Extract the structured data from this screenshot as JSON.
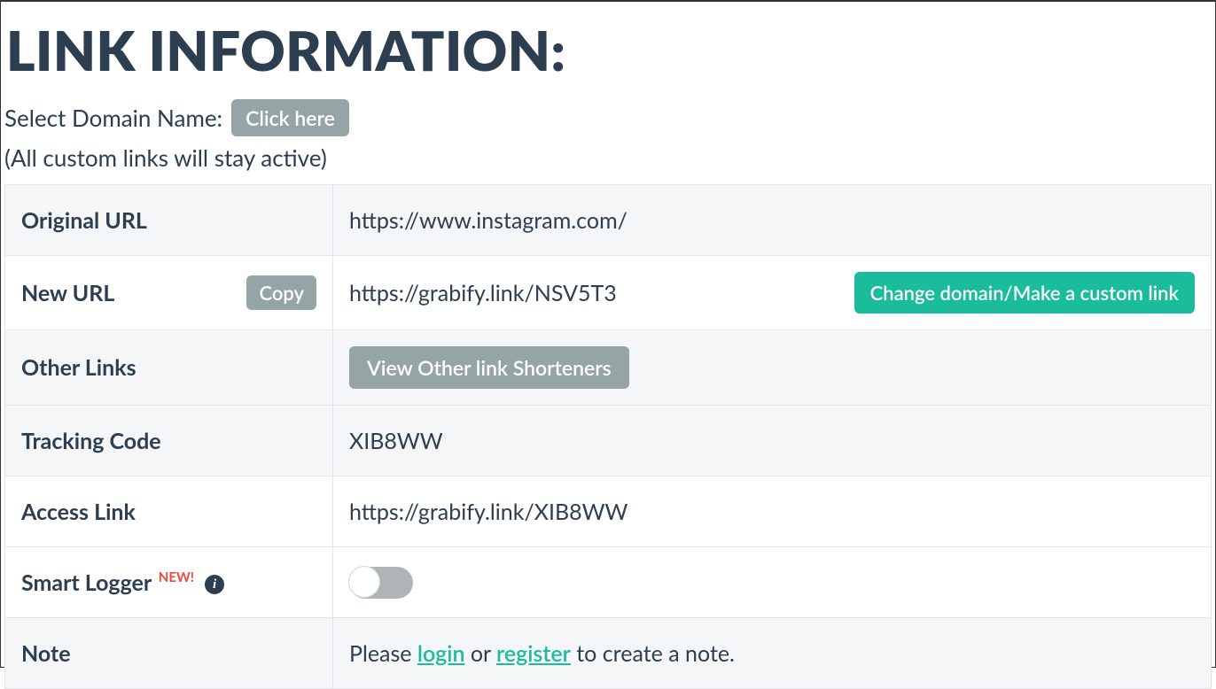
{
  "title": "LINK INFORMATION:",
  "domain_select": {
    "label": "Select Domain Name:",
    "button": "Click here"
  },
  "sub_note": "(All custom links will stay active)",
  "rows": {
    "original_url": {
      "label": "Original URL",
      "value": "https://www.instagram.com/"
    },
    "new_url": {
      "label": "New URL",
      "copy_btn": "Copy",
      "value": "https://grabify.link/NSV5T3",
      "change_btn": "Change domain/Make a custom link"
    },
    "other_links": {
      "label": "Other Links",
      "view_btn": "View Other link Shorteners"
    },
    "tracking_code": {
      "label": "Tracking Code",
      "value": "XIB8WW"
    },
    "access_link": {
      "label": "Access Link",
      "value": "https://grabify.link/XIB8WW"
    },
    "smart_logger": {
      "label": "Smart Logger",
      "badge": "NEW!",
      "enabled": false
    },
    "note": {
      "label": "Note",
      "prefix": "Please ",
      "login": "login",
      "middle": " or ",
      "register": "register",
      "suffix": " to create a note."
    }
  }
}
